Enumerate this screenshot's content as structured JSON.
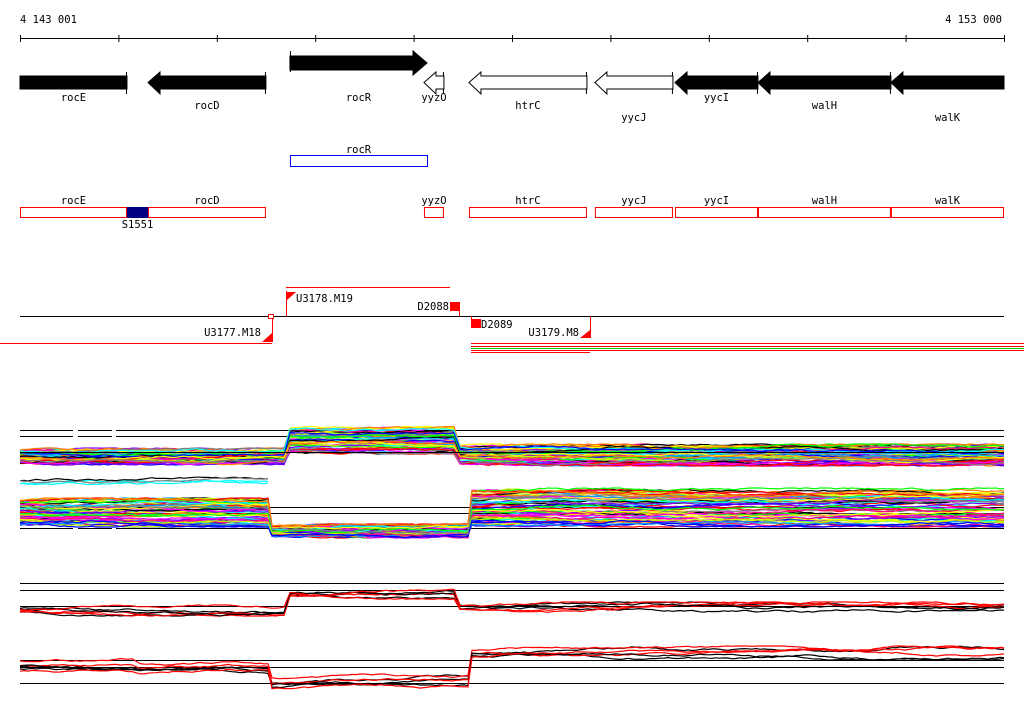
{
  "ruler": {
    "start_label": "4 143 001",
    "end_label": "4 153 000",
    "start": 4143001,
    "end": 4153000,
    "ticks": 10
  },
  "genes": [
    {
      "name": "rocE",
      "start": 4143001,
      "end": 4144088,
      "strand": "-",
      "filled": true,
      "truncated": "head"
    },
    {
      "name": "rocD",
      "start": 4144302,
      "end": 4145500,
      "strand": "-",
      "filled": true
    },
    {
      "name": "rocR",
      "start": 4145744,
      "end": 4147137,
      "strand": "+",
      "filled": true
    },
    {
      "name": "yyzO",
      "start": 4147106,
      "end": 4147309,
      "strand": "-",
      "filled": false
    },
    {
      "name": "htrC",
      "start": 4147563,
      "end": 4148762,
      "strand": "-",
      "filled": false
    },
    {
      "name": "yycJ",
      "start": 4148843,
      "end": 4149636,
      "strand": "-",
      "filled": false
    },
    {
      "name": "yycI",
      "start": 4149657,
      "end": 4150500,
      "strand": "-",
      "filled": true
    },
    {
      "name": "walH",
      "start": 4150500,
      "end": 4151851,
      "strand": "-",
      "filled": true
    },
    {
      "name": "walK",
      "start": 4151851,
      "end": 4153000,
      "strand": "-",
      "filled": true,
      "truncated": "tail"
    }
  ],
  "regulon": {
    "name": "rocR",
    "start": 4145744,
    "end": 4147137,
    "color": "#0000ff"
  },
  "operons": [
    {
      "name": "rocE",
      "start": 4143001,
      "end": 4144088
    },
    {
      "name": "rocD",
      "start": 4144302,
      "end": 4145500
    },
    {
      "name": "yyzO",
      "start": 4147106,
      "end": 4147309
    },
    {
      "name": "htrC",
      "start": 4147563,
      "end": 4148762
    },
    {
      "name": "yycJ",
      "start": 4148843,
      "end": 4149636
    },
    {
      "name": "yycI",
      "start": 4149657,
      "end": 4150500
    },
    {
      "name": "walH",
      "start": 4150500,
      "end": 4151851
    },
    {
      "name": "walK",
      "start": 4151851,
      "end": 4153000
    }
  ],
  "site": {
    "name": "S1551",
    "start": 4144088,
    "end": 4144302,
    "color": "#000080"
  },
  "transcription_units": [
    {
      "name": "U3177.M18",
      "strand": "-"
    },
    {
      "name": "U3178.M19",
      "strand": "+"
    },
    {
      "name": "D2088",
      "type": "down"
    },
    {
      "name": "D2089",
      "type": "down"
    },
    {
      "name": "U3179.M8",
      "strand": "-"
    }
  ],
  "colors": {
    "operon": "#ff0000",
    "tu": "#ff0000",
    "gene": "#000000"
  }
}
